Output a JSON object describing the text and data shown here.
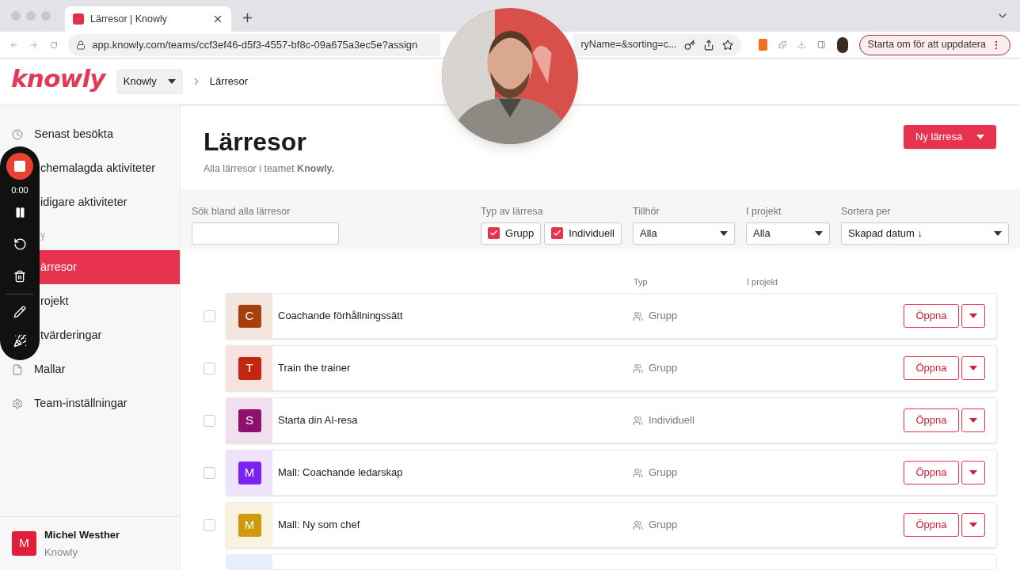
{
  "browser": {
    "tab_title": "Lärresor | Knowly",
    "url_visible": "app.knowly.com/teams/ccf3ef46-d5f3-4557-bf8c-09a675a3ec5e?assign",
    "url_tail": "ryName=&sorting=c...",
    "update_button": "Starta om för att uppdatera"
  },
  "header": {
    "logo": "knowly",
    "team": "Knowly",
    "page": "Lärresor"
  },
  "sidebar": {
    "items": [
      {
        "kind": "link",
        "label": "Senast besökta",
        "selected": false
      },
      {
        "kind": "link",
        "label": "chemalagda aktiviteter",
        "selected": false
      },
      {
        "kind": "link",
        "label": "idigare aktiviteter",
        "selected": false
      },
      {
        "kind": "section",
        "label": "y"
      },
      {
        "kind": "link",
        "label": "ärresor",
        "selected": true
      },
      {
        "kind": "link",
        "label": "rojekt",
        "selected": false
      },
      {
        "kind": "link",
        "label": "tvärderingar",
        "selected": false
      },
      {
        "kind": "link",
        "label": "Mallar",
        "selected": false
      },
      {
        "kind": "link",
        "label": "Team-inställningar",
        "selected": false
      }
    ],
    "user": {
      "initial": "M",
      "name": "Michel Westher",
      "team": "Knowly"
    }
  },
  "recorder": {
    "time": "0:00"
  },
  "page": {
    "title": "Lärresor",
    "subtitle": "Alla lärresor i teamet **Knowly.**",
    "new_button": "Ny lärresa"
  },
  "filters": {
    "search": {
      "label": "Sök bland alla lärresor"
    },
    "type": {
      "label": "Typ av lärresa",
      "options": [
        {
          "label": "Grupp",
          "checked": true
        },
        {
          "label": "Individuell",
          "checked": true
        }
      ]
    },
    "selects": [
      {
        "label": "Tillhör",
        "value": "Alla"
      },
      {
        "label": "I projekt",
        "value": "Alla"
      },
      {
        "label": "Sortera per",
        "value": "Skapad datum ↓"
      }
    ]
  },
  "table": {
    "columns": [
      "Typ",
      "I projekt"
    ],
    "rows": [
      {
        "initial": "C",
        "name": "Coachande förhållningssätt",
        "color": "#a5400e",
        "type": "Grupp",
        "action": "Öppna",
        "checked": false
      },
      {
        "initial": "T",
        "name": "Train the trainer",
        "color": "#c2260f",
        "type": "Grupp",
        "action": "Öppna",
        "checked": false
      },
      {
        "initial": "S",
        "name": "Starta din AI-resa",
        "color": "#8e0f6e",
        "type": "Individuell",
        "action": "Öppna",
        "checked": false
      },
      {
        "initial": "M",
        "name": "Mall: Coachande ledarskap",
        "color": "#7c22f0",
        "type": "Grupp",
        "action": "Öppna",
        "checked": false
      },
      {
        "initial": "M",
        "name": "Mall: Ny som chef",
        "color": "#cf9a0c",
        "type": "Grupp",
        "action": "Öppna",
        "checked": false
      }
    ]
  }
}
